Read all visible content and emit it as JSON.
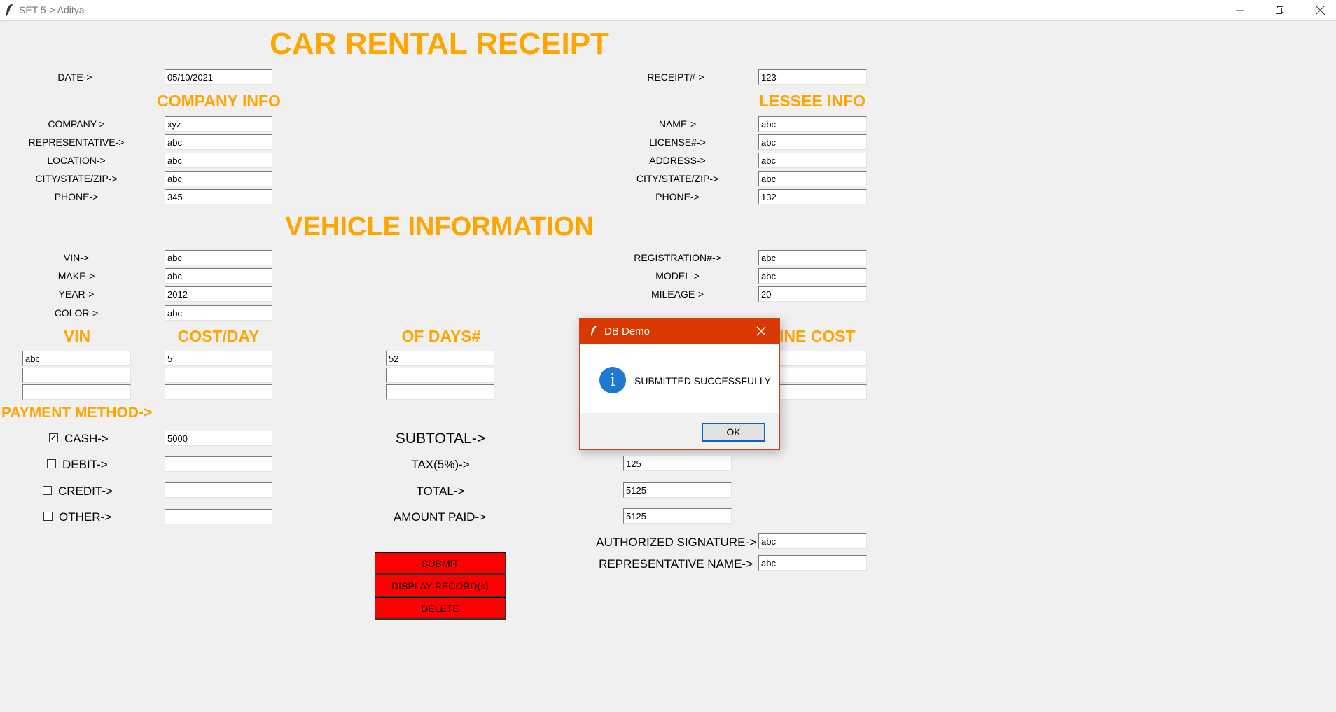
{
  "window": {
    "title": "SET 5-> Aditya"
  },
  "page_title": "CAR RENTAL RECEIPT",
  "date": {
    "label": "DATE->",
    "value": "05/10/2021"
  },
  "receipt": {
    "label": "RECEIPT#->",
    "value": "123"
  },
  "company_info": {
    "heading": "COMPANY INFO",
    "fields": [
      {
        "label": "COMPANY->",
        "value": "xyz"
      },
      {
        "label": "REPRESENTATIVE->",
        "value": "abc"
      },
      {
        "label": "LOCATION->",
        "value": "abc"
      },
      {
        "label": "CITY/STATE/ZIP->",
        "value": "abc"
      },
      {
        "label": "PHONE->",
        "value": "345"
      }
    ]
  },
  "lessee_info": {
    "heading": "LESSEE INFO",
    "fields": [
      {
        "label": "NAME->",
        "value": "abc"
      },
      {
        "label": "LICENSE#->",
        "value": "abc"
      },
      {
        "label": "ADDRESS->",
        "value": "abc"
      },
      {
        "label": "CITY/STATE/ZIP->",
        "value": "abc"
      },
      {
        "label": "PHONE->",
        "value": "132"
      }
    ]
  },
  "vehicle_info": {
    "heading": "VEHICLE INFORMATION",
    "left_fields": [
      {
        "label": "VIN->",
        "value": "abc"
      },
      {
        "label": "MAKE->",
        "value": "abc"
      },
      {
        "label": "YEAR->",
        "value": "2012"
      },
      {
        "label": "COLOR->",
        "value": "abc"
      }
    ],
    "right_fields": [
      {
        "label": "REGISTRATION#->",
        "value": "abc"
      },
      {
        "label": "MODEL->",
        "value": "abc"
      },
      {
        "label": "MILEAGE->",
        "value": "20"
      }
    ]
  },
  "line_items": {
    "headers": {
      "vin": "VIN",
      "cost_day": "COST/DAY",
      "days": "OF DAYS#",
      "line_cost_partial": "INE COST"
    },
    "rows": [
      {
        "vin": "abc",
        "cost_day": "5",
        "days": "52",
        "line_cost": ""
      },
      {
        "vin": "",
        "cost_day": "",
        "days": "",
        "line_cost": ""
      },
      {
        "vin": "",
        "cost_day": "",
        "days": "",
        "line_cost": ""
      }
    ]
  },
  "payment": {
    "heading": "PAYMENT METHOD->",
    "methods": [
      {
        "label": "CASH->",
        "checked": true,
        "value": "5000",
        "check_mark": "✓"
      },
      {
        "label": "DEBIT->",
        "checked": false,
        "value": "",
        "check_mark": ""
      },
      {
        "label": "CREDIT->",
        "checked": false,
        "value": "",
        "check_mark": ""
      },
      {
        "label": "OTHER->",
        "checked": false,
        "value": "",
        "check_mark": ""
      }
    ]
  },
  "totals": {
    "subtotal_label": "SUBTOTAL->",
    "tax_label": "TAX(5%)->",
    "tax_value": "125",
    "total_label": "TOTAL->",
    "total_value": "5125",
    "amount_paid_label": "AMOUNT PAID->",
    "amount_paid_value": "5125"
  },
  "signature": {
    "auth_label": "AUTHORIZED SIGNATURE->",
    "auth_value": "abc",
    "rep_label": "REPRESENTATIVE NAME->",
    "rep_value": "abc"
  },
  "buttons": {
    "submit": "SUBMIT",
    "display": "DISPLAY RECORD(s)",
    "delete": "DELETE"
  },
  "dialog": {
    "title": "DB Demo",
    "message": "SUBMITTED SUCCESSFULLY",
    "ok_label": "OK",
    "info_glyph": "i",
    "icon": "info-icon"
  },
  "colors": {
    "heading": "#ffa500",
    "button": "#ff0000",
    "dialog_title": "#d93800",
    "info_icon": "#1f78d1"
  }
}
